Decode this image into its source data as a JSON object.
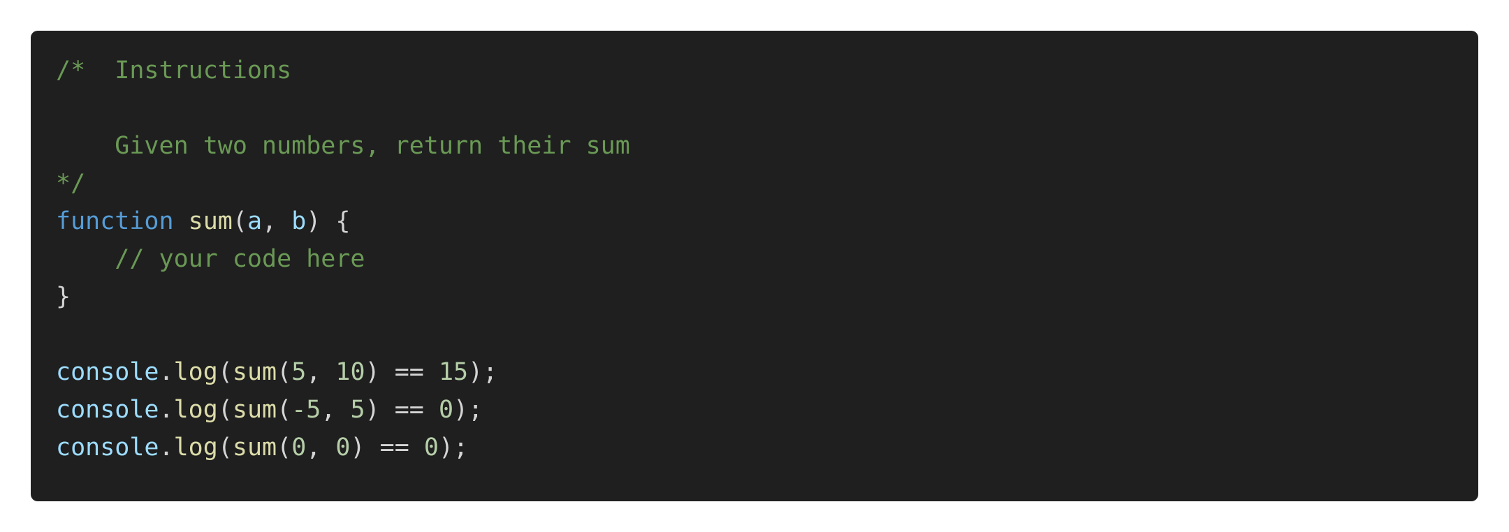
{
  "colors": {
    "background": "#ffffff",
    "panel": "#1f1f1f",
    "comment": "#6a9955",
    "keyword": "#569cd6",
    "function": "#dcdcaa",
    "identifier": "#9cdcfe",
    "number": "#b5cea8",
    "plain": "#d4d4d4"
  },
  "code": {
    "line1": {
      "text": "/*  Instructions"
    },
    "line2": {
      "text": ""
    },
    "line3": {
      "text": "    Given two numbers, return their sum"
    },
    "line4": {
      "text": "*/"
    },
    "line5": {
      "keyword": "function",
      "fn": "sum",
      "open": "(",
      "p1": "a",
      "comma": ", ",
      "p2": "b",
      "close": ") {"
    },
    "line6": {
      "comment": "    // your code here"
    },
    "line7": {
      "text": "}"
    },
    "line8": {
      "text": ""
    },
    "line9": {
      "obj": "console",
      "dot": ".",
      "method": "log",
      "open1": "(",
      "fn": "sum",
      "open2": "(",
      "a": "5",
      "comma": ", ",
      "b": "10",
      "close2": ") == ",
      "expected": "15",
      "end": ");"
    },
    "line10": {
      "obj": "console",
      "dot": ".",
      "method": "log",
      "open1": "(",
      "fn": "sum",
      "open2": "(",
      "a": "-5",
      "comma": ", ",
      "b": "5",
      "close2": ") == ",
      "expected": "0",
      "end": ");"
    },
    "line11": {
      "obj": "console",
      "dot": ".",
      "method": "log",
      "open1": "(",
      "fn": "sum",
      "open2": "(",
      "a": "0",
      "comma": ", ",
      "b": "0",
      "close2": ") == ",
      "expected": "0",
      "end": ");"
    }
  }
}
